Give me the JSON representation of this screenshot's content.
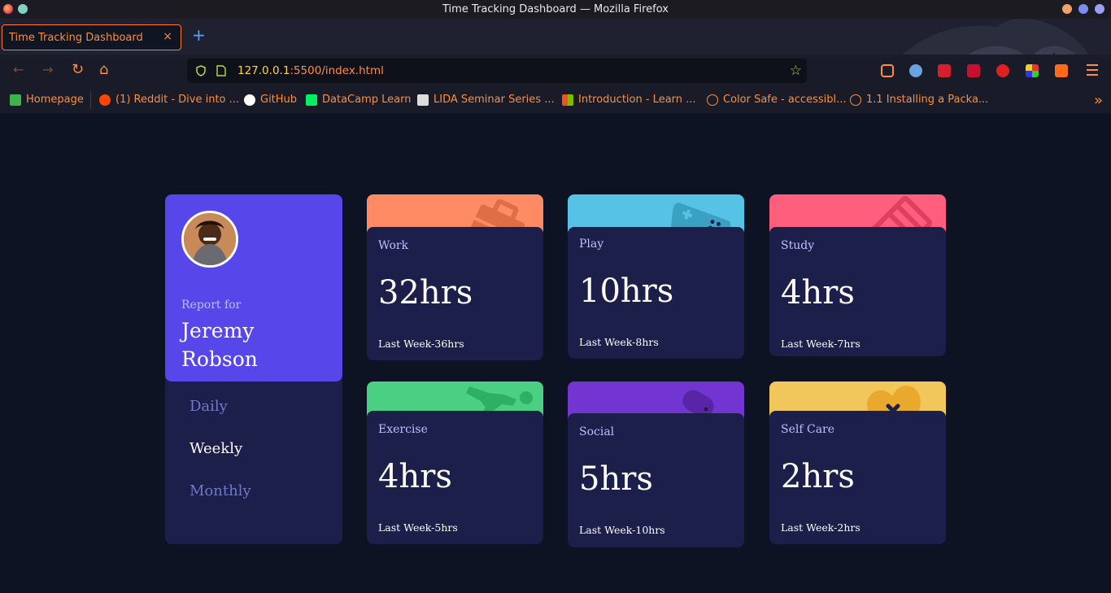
{
  "window": {
    "title": "Time Tracking Dashboard — Mozilla Firefox"
  },
  "tab": {
    "label": "Time Tracking Dashboard",
    "close": "×",
    "new_tab": "+"
  },
  "nav": {
    "back": "←",
    "forward": "→",
    "reload": "↻",
    "home": "⌂",
    "url_host": "127.0.0.1",
    "url_path": ":5500/index.html",
    "bookmark_star": "☆"
  },
  "bookmarks": [
    {
      "label": "Homepage",
      "icon": "homepage-icon",
      "color": "#3cb44b"
    },
    {
      "label": "(1) Reddit - Dive into ...",
      "icon": "reddit-icon",
      "color": "#ff4500"
    },
    {
      "label": "GitHub",
      "icon": "github-icon",
      "color": "#ffffff"
    },
    {
      "label": "DataCamp Learn",
      "icon": "datacamp-icon",
      "color": "#03ef62"
    },
    {
      "label": "LIDA Seminar Series ...",
      "icon": "lida-icon",
      "color": "#dddddd"
    },
    {
      "label": "Introduction - Learn ...",
      "icon": "microsoft-icon",
      "color": "#f25022"
    },
    {
      "label": "Color Safe - accessibl...",
      "icon": "globe-icon",
      "color": "#ff8d3a"
    },
    {
      "label": "1.1 Installing a Packa...",
      "icon": "globe-icon",
      "color": "#ff8d3a"
    }
  ],
  "bookmarks_more": "»",
  "profile": {
    "report_for": "Report for",
    "name": "Jeremy Robson",
    "periods": {
      "daily": "Daily",
      "weekly": "Weekly",
      "monthly": "Monthly"
    },
    "active_period": "weekly"
  },
  "cards": {
    "work": {
      "title": "Work",
      "current": "32hrs",
      "previous": "Last Week-36hrs",
      "color": "#ff8b64"
    },
    "play": {
      "title": "Play",
      "current": "10hrs",
      "previous": "Last Week-8hrs",
      "color": "#55c2e6"
    },
    "study": {
      "title": "Study",
      "current": "4hrs",
      "previous": "Last Week-7hrs",
      "color": "#ff5e7d"
    },
    "exercise": {
      "title": "Exercise",
      "current": "4hrs",
      "previous": "Last Week-5hrs",
      "color": "#4bcf82"
    },
    "social": {
      "title": "Social",
      "current": "5hrs",
      "previous": "Last Week-10hrs",
      "color": "#7335d2"
    },
    "selfcare": {
      "title": "Self Care",
      "current": "2hrs",
      "previous": "Last Week-2hrs",
      "color": "#f1c75b"
    }
  },
  "colors": {
    "page_bg": "#0d1323",
    "card_bg": "#1c1f4a",
    "profile_accent": "#5747ea",
    "muted_text": "#bbc0ff",
    "inactive_period": "#7078c9"
  }
}
